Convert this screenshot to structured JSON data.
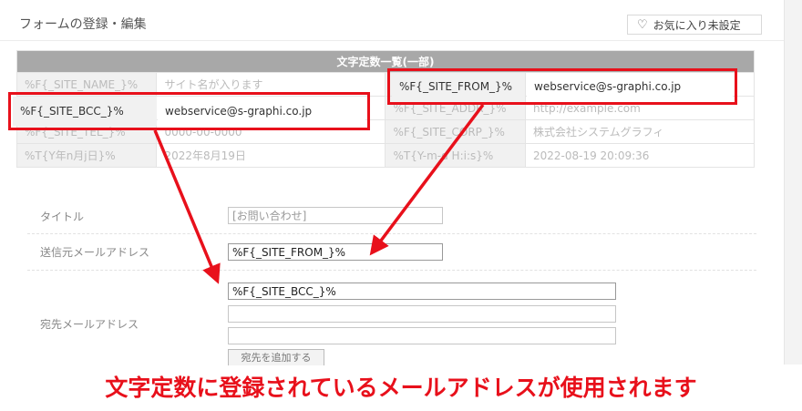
{
  "header": {
    "title": "フォームの登録・編集",
    "favorite_label": "お気に入り未設定"
  },
  "constants_table": {
    "caption": "文字定数一覧(一部)",
    "rows": [
      {
        "key1": "%F{_SITE_NAME_}%",
        "val1": "サイト名が入ります",
        "key2": "%F{_SITE_FROM_}%",
        "val2": "webservice@s-graphi.co.jp"
      },
      {
        "key1": "%F{_SITE_BCC_}%",
        "val1": "webservice@s-graphi.co.jp",
        "key2": "%F{_SITE_ADDR_}%",
        "val2": "http://example.com"
      },
      {
        "key1": "%F{_SITE_TEL_}%",
        "val1": "0000-00-0000",
        "key2": "%F{_SITE_CORP_}%",
        "val2": "株式会社システムグラフィ"
      },
      {
        "key1": "%T{Y年n月j日}%",
        "val1": "2022年8月19日",
        "key2": "%T{Y-m-d H:i:s}%",
        "val2": "2022-08-19 20:09:36"
      }
    ]
  },
  "form": {
    "title_label": "タイトル",
    "title_value": "[お問い合わせ]",
    "from_label": "送信元メールアドレス",
    "from_value": "%F{_SITE_FROM_}%",
    "to_label": "宛先メールアドレス",
    "to_values": [
      "%F{_SITE_BCC_}%",
      "",
      ""
    ],
    "add_button": "宛先を追加する"
  },
  "annotation": {
    "caption": "文字定数に登録されているメールアドレスが使用されます",
    "color": "#e8101b"
  }
}
